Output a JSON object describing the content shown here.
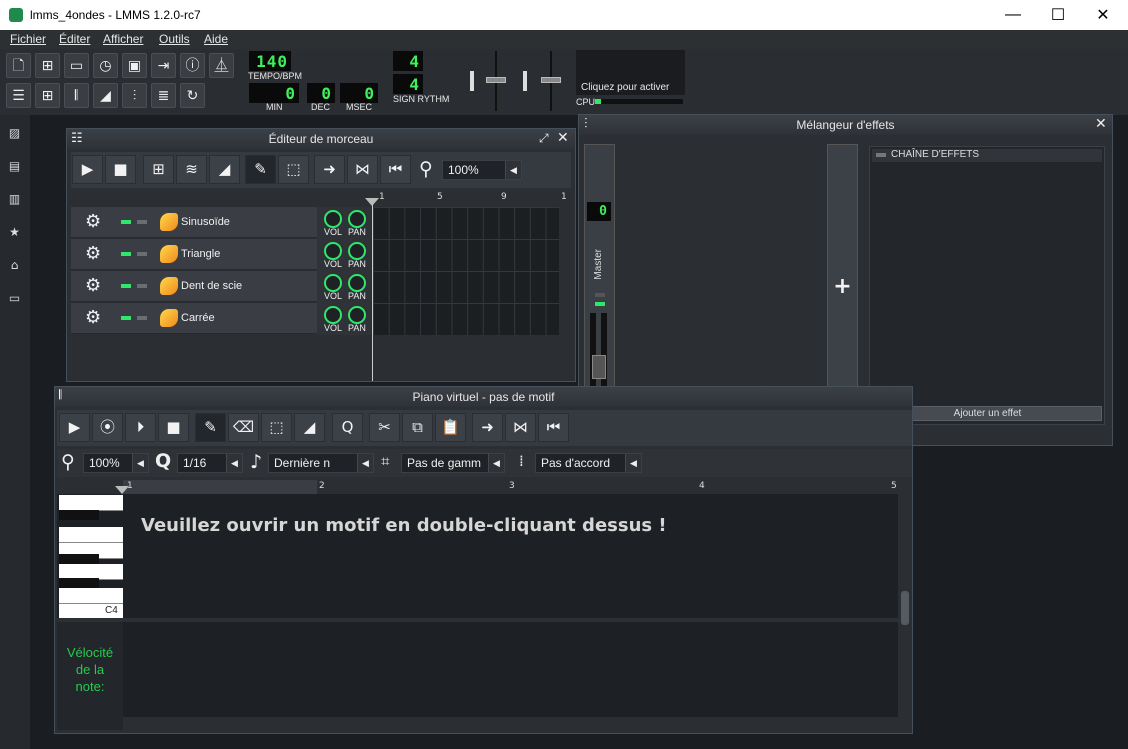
{
  "window": {
    "title": "lmms_4ondes - LMMS 1.2.0-rc7",
    "min": "—",
    "max": "☐",
    "close": "✕"
  },
  "menu": [
    "Fichier",
    "Éditer",
    "Afficher",
    "Outils",
    "Aide"
  ],
  "transport": {
    "tempo": "140",
    "tempo_label": "TEMPO/BPM",
    "min": "0",
    "min_label": "MIN",
    "dec": "0",
    "dec_label": "DEC",
    "msec": "0",
    "msec_label": "MSEC",
    "sig_num": "4",
    "sig_den": "4",
    "sig_label": "SIGN RYTHM",
    "cpu_hint": "Cliquez pour activer",
    "cpu_label": "CPU"
  },
  "song_editor": {
    "title": "Éditeur de morceau",
    "zoom": "100%",
    "timeline": [
      "1",
      "5",
      "9",
      "1"
    ],
    "tracks": [
      {
        "name": "Sinusoïde",
        "vol": "VOL",
        "pan": "PAN"
      },
      {
        "name": "Triangle",
        "vol": "VOL",
        "pan": "PAN"
      },
      {
        "name": "Dent de scie",
        "vol": "VOL",
        "pan": "PAN"
      },
      {
        "name": "Carrée",
        "vol": "VOL",
        "pan": "PAN"
      }
    ]
  },
  "fx_mixer": {
    "title": "Mélangeur d'effets",
    "master_label": "Master",
    "master_value": "0",
    "chain_label": "CHAÎNE D'EFFETS",
    "add_effect": "Ajouter un effet",
    "add_channel": "+"
  },
  "piano_roll": {
    "title": "Piano virtuel - pas de motif",
    "zoom": "100%",
    "quant": "1/16",
    "note_len": "Dernière n",
    "scale": "Pas de gamm",
    "chord": "Pas d'accord",
    "timeline": [
      "1",
      "2",
      "3",
      "4",
      "5"
    ],
    "key_label": "C4",
    "message": "Veuillez ouvrir un motif en double-cliquant dessus !",
    "velocity_label": [
      "Vélocité",
      "de la",
      "note:"
    ]
  },
  "colors": {
    "accent_green": "#2ee86a",
    "lcd_green": "#3ef05a",
    "velocity_text": "#27c94f"
  }
}
